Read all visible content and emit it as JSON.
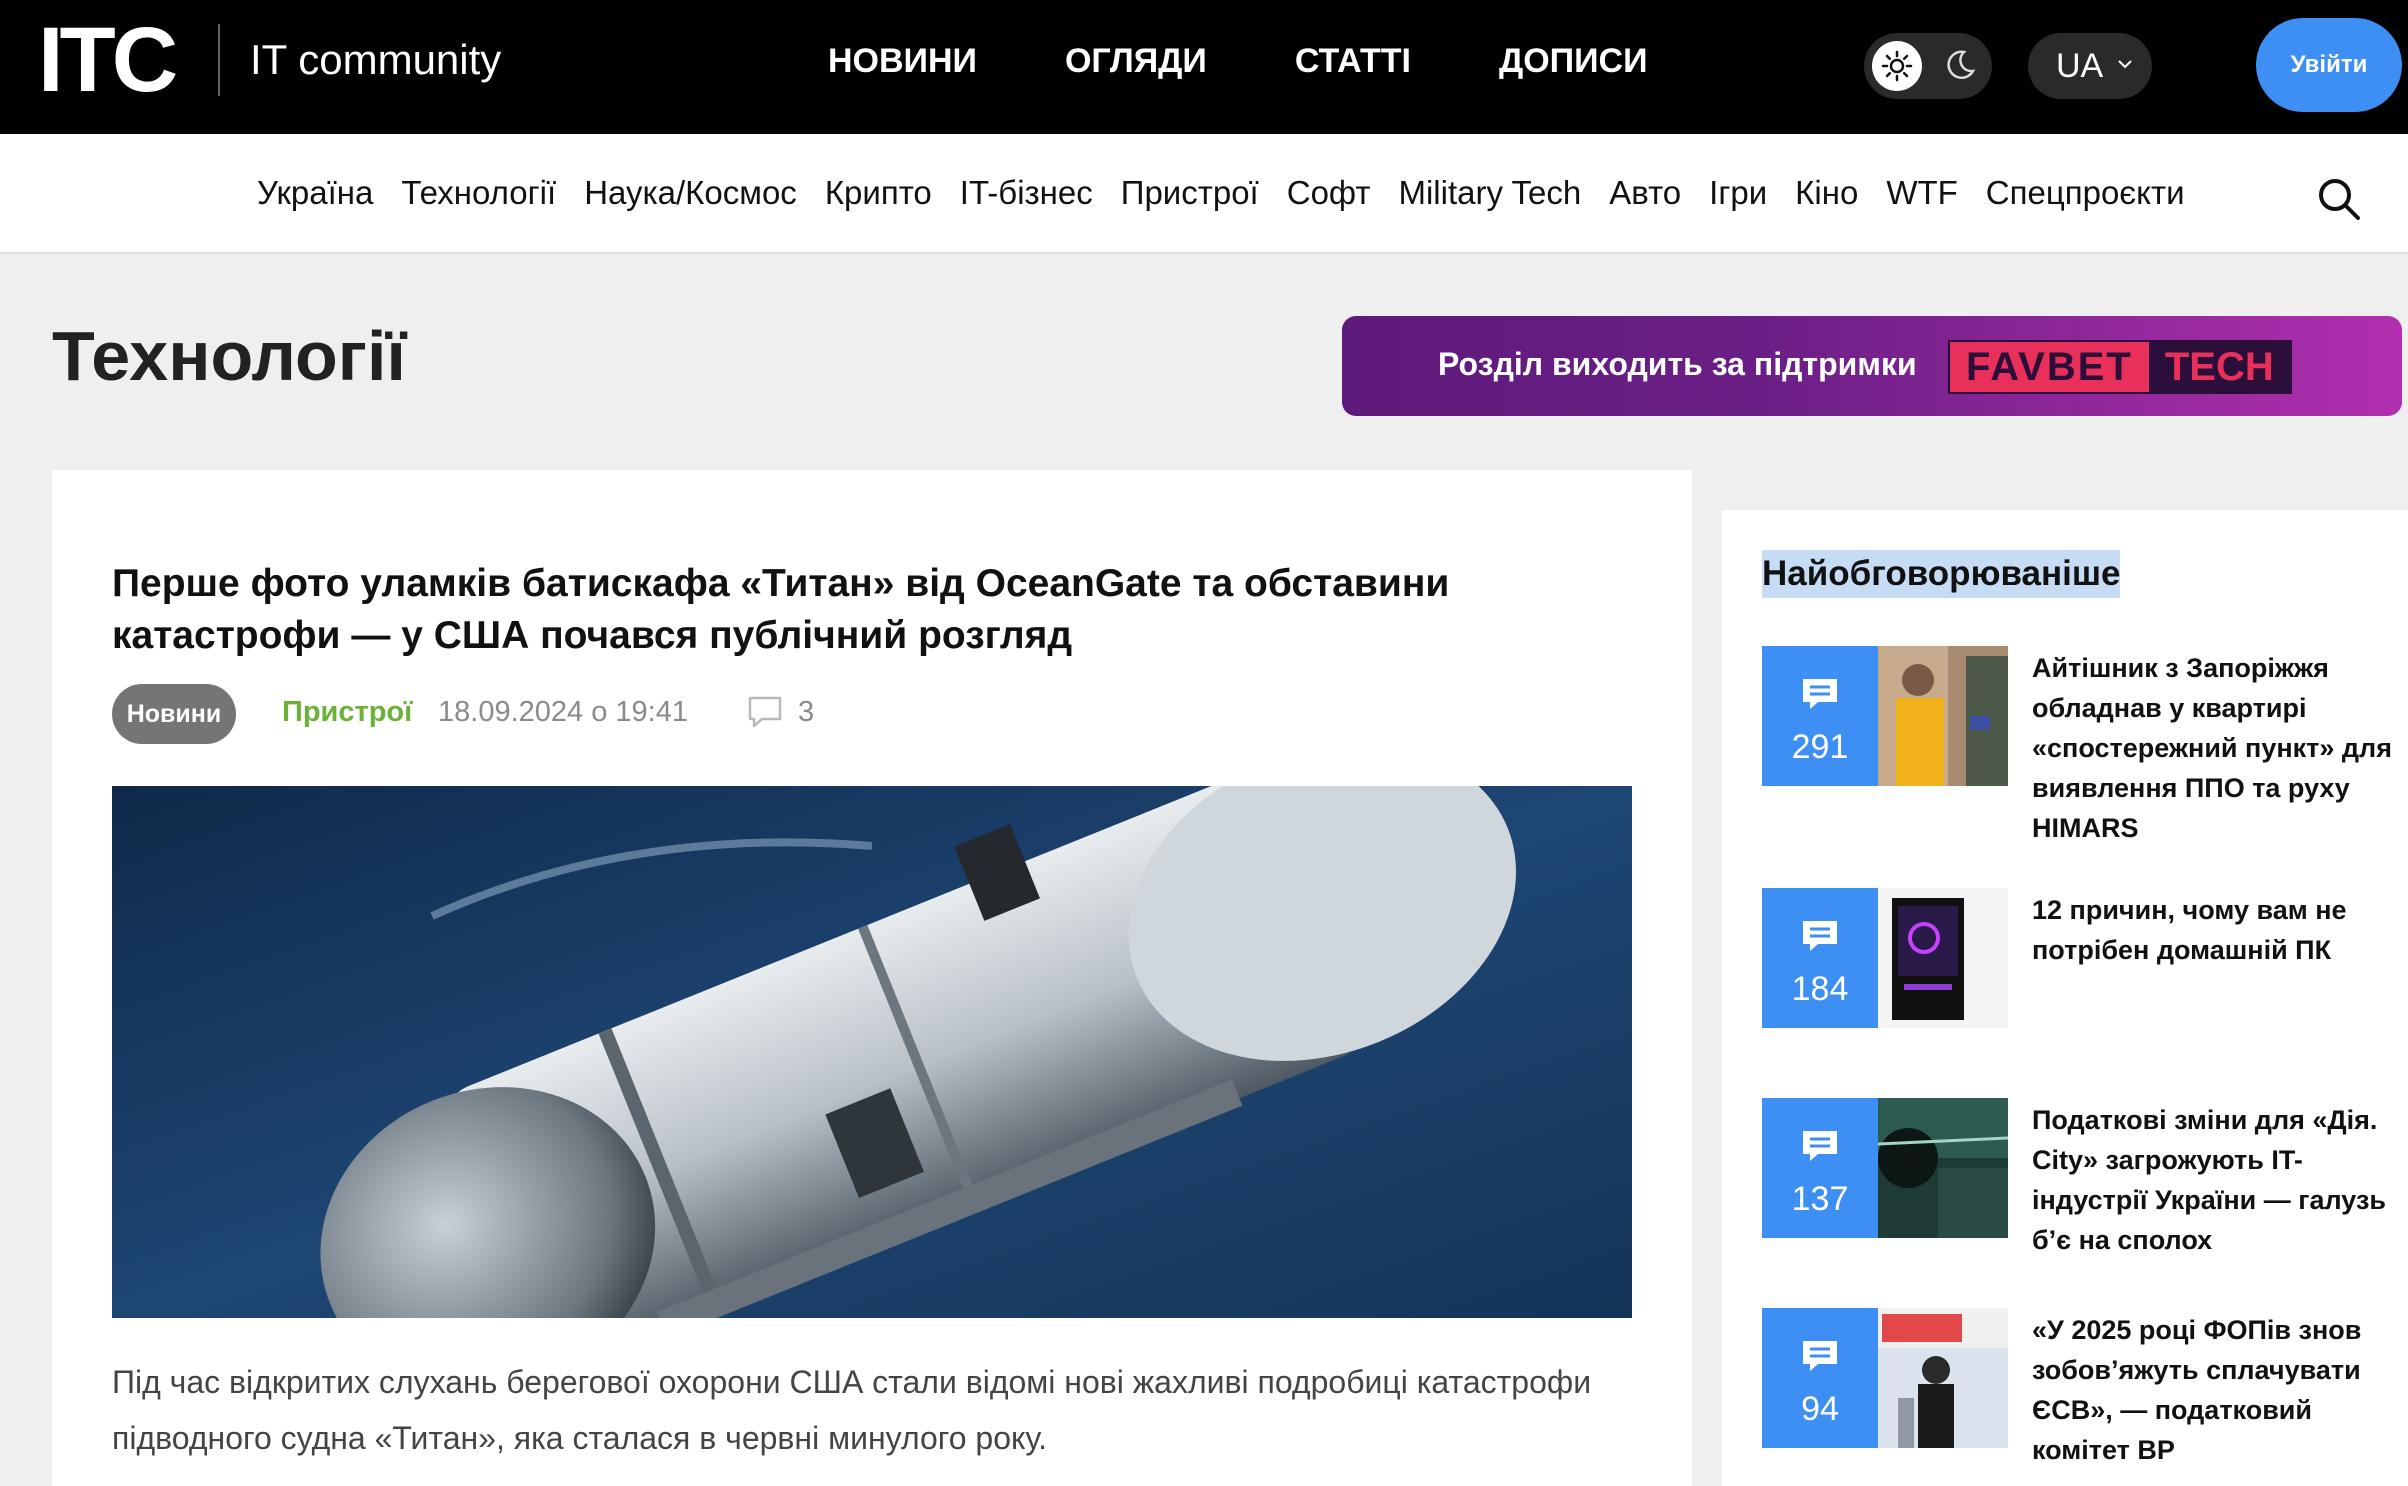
{
  "header": {
    "logo_text": "ITC",
    "community_label": "IT community",
    "main_nav": [
      "НОВИНИ",
      "ОГЛЯДИ",
      "СТАТТІ",
      "ДОПИСИ"
    ],
    "language": "UA",
    "login_label": "Увійти"
  },
  "categories": [
    "Україна",
    "Технології",
    "Наука/Космос",
    "Крипто",
    "IT-бізнес",
    "Пристрої",
    "Софт",
    "Military Tech",
    "Авто",
    "Ігри",
    "Кіно",
    "WTF",
    "Спецпроєкти"
  ],
  "page": {
    "title": "Технології",
    "banner_text": "Розділ виходить за підтримки",
    "banner_brand_1": "FAVBET",
    "banner_brand_2": "TECH"
  },
  "article": {
    "title": "Перше фото уламків батискафа «Титан» від OceanGate та обставини катастрофи — у США почався публічний розгляд",
    "badge": "Новини",
    "category": "Пристрої",
    "date": "18.09.2024 о 19:41",
    "comments": "3",
    "lede": "Під час відкритих слухань берегової охорони США стали відомі нові жахливі подробиці катастрофи підводного судна «Титан», яка сталася в червні минулого року."
  },
  "sidebar": {
    "title": "Найобговорюваніше",
    "items": [
      {
        "count": "291",
        "text": "Айтішник з Запоріжжя обладнав у квартирі «спостережний пункт» для виявлення ППО та руху HIMARS"
      },
      {
        "count": "184",
        "text": "12 причин, чому вам не потрібен домашній ПК"
      },
      {
        "count": "137",
        "text": "Податкові зміни для «Дія. City» загрожують IT-індустрії України — галузь б’є на сполох"
      },
      {
        "count": "94",
        "text": "«У 2025 році ФОПів знов зобов’яжуть сплачувати ЄСВ», — податковий комітет ВР"
      }
    ]
  },
  "colors": {
    "accent": "#3d8ff3",
    "category_green": "#6bb13a",
    "topbar": "#000000"
  }
}
